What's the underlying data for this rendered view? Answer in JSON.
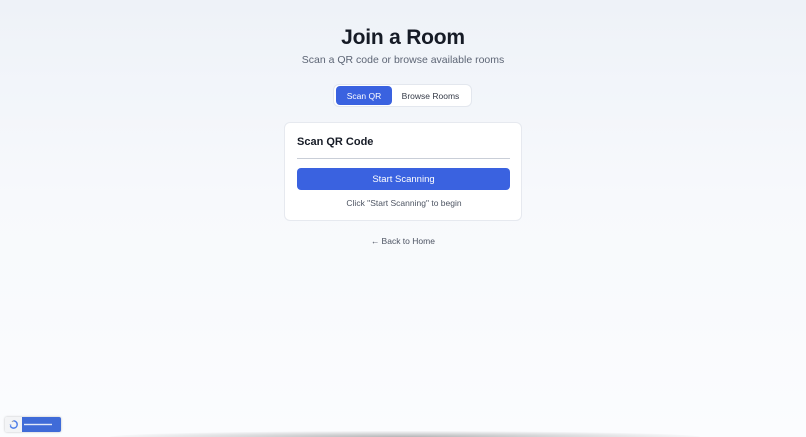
{
  "header": {
    "title": "Join a Room",
    "subtitle": "Scan a QR code or browse available rooms"
  },
  "tabs": [
    {
      "label": "Scan QR",
      "active": true
    },
    {
      "label": "Browse Rooms",
      "active": false
    }
  ],
  "scan_card": {
    "title": "Scan QR Code",
    "button_label": "Start Scanning",
    "hint": "Click \"Start Scanning\" to begin"
  },
  "back_link": {
    "arrow": "←",
    "label": "Back to Home"
  },
  "recaptcha": {
    "icon": "recaptcha-icon"
  },
  "colors": {
    "accent": "#3a62e0",
    "background_top": "#eef2f8",
    "text_primary": "#161b26",
    "text_secondary": "#5d6575"
  }
}
